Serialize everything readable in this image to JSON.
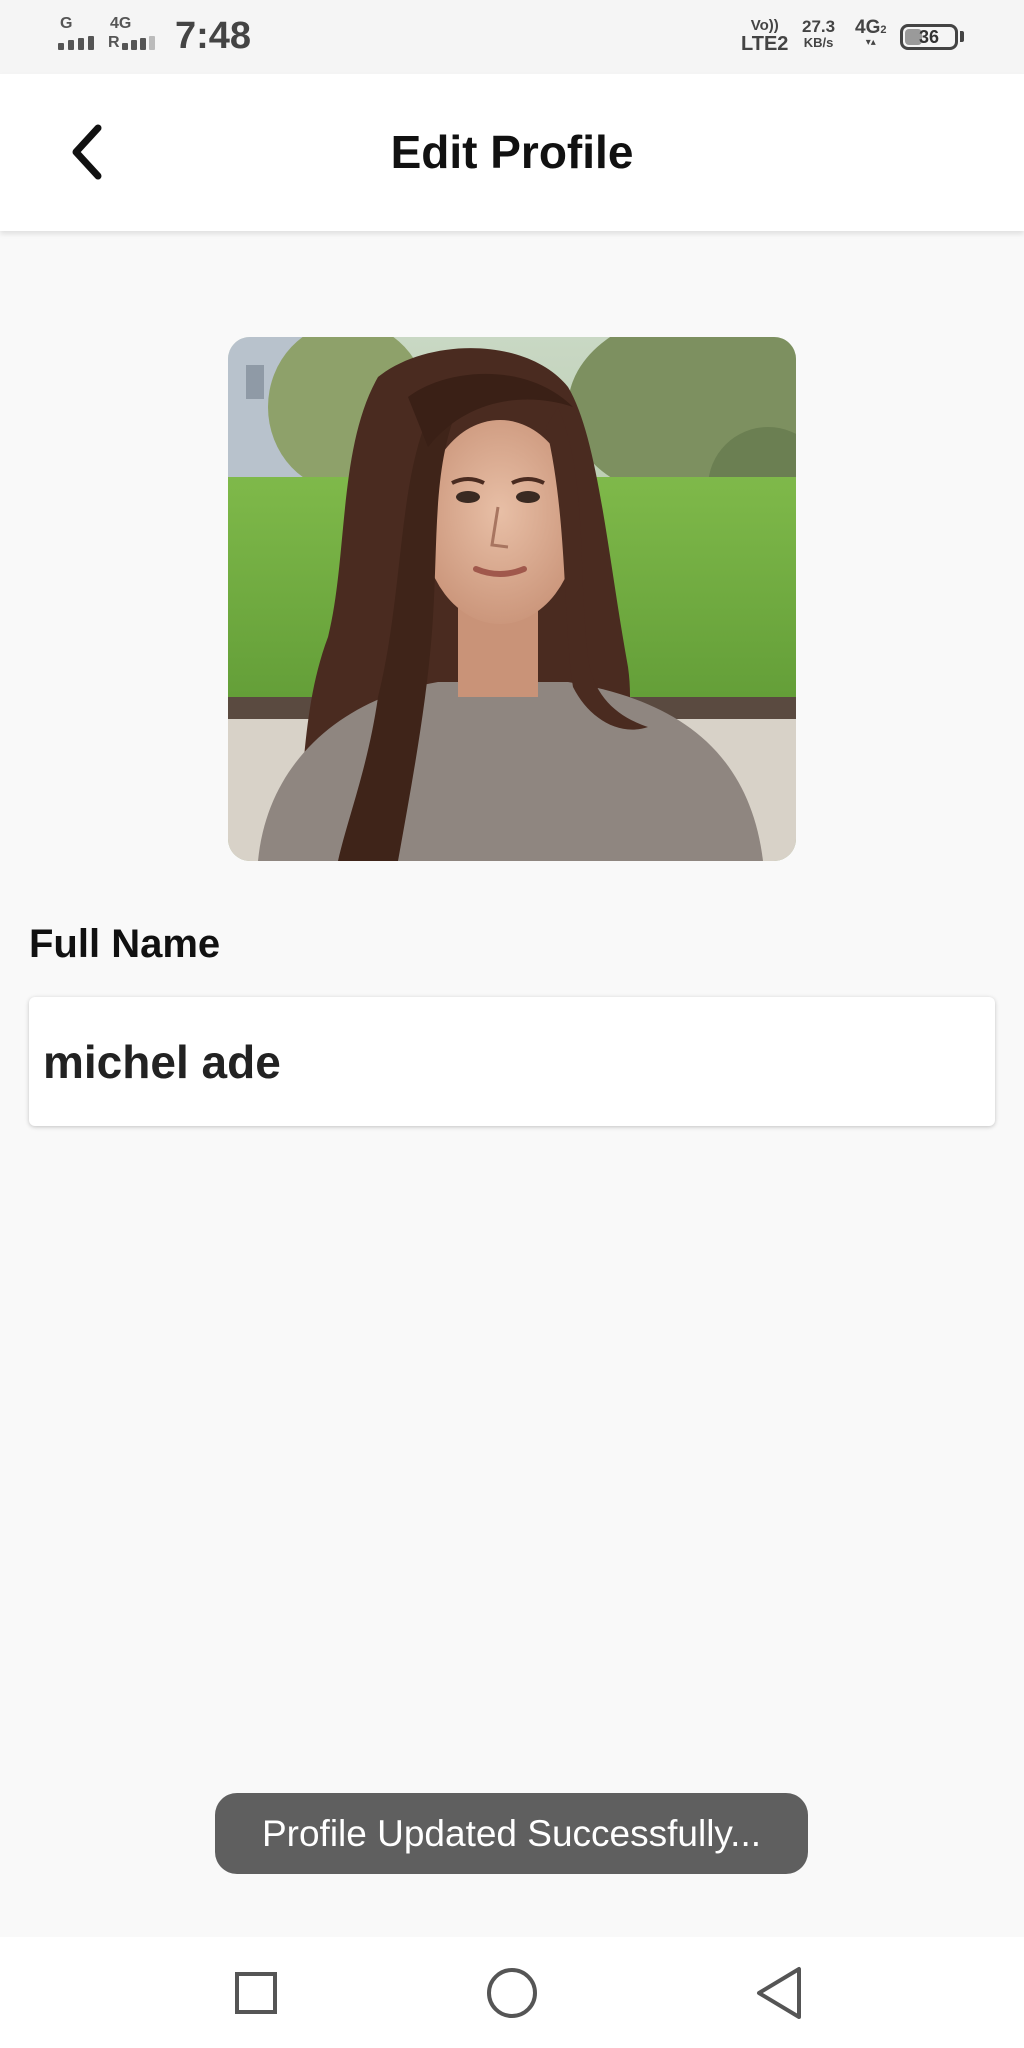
{
  "status_bar": {
    "network_1": "G",
    "network_2": "4G",
    "network_2_sub": "R",
    "time": "7:48",
    "volte_top": "Vo))",
    "volte_bottom": "LTE2",
    "speed_value": "27.3",
    "speed_unit": "KB/s",
    "data_type": "4G",
    "data_sub": "2",
    "battery_level": "36",
    "battery_fraction": 0.36
  },
  "header": {
    "title": "Edit Profile"
  },
  "profile": {
    "full_name_label": "Full Name",
    "full_name_value": "michel ade"
  },
  "toast": {
    "message": "Profile Updated Successfully..."
  },
  "icons": {
    "back": "chevron-left-icon",
    "recents": "square-icon",
    "home": "circle-icon",
    "back_nav": "triangle-left-icon"
  }
}
